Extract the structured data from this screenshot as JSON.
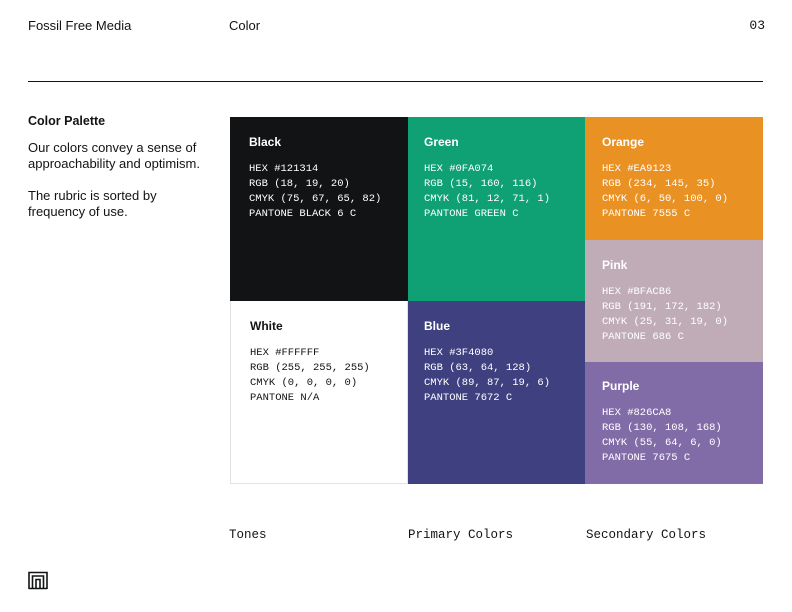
{
  "header": {
    "brand": "Fossil Free Media",
    "section": "Color",
    "page_number": "03"
  },
  "sidebar": {
    "heading": "Color Palette",
    "paragraph_1": "Our colors convey a sense of approachability and optimism.",
    "paragraph_2": "The rubric is sorted by frequency of use."
  },
  "colors": {
    "black": {
      "name": "Black",
      "hex": "HEX #121314",
      "rgb": "RGB (18, 19, 20)",
      "cmyk": "CMYK (75, 67, 65, 82)",
      "pantone": "PANTONE BLACK 6 C",
      "swatch": "#121314"
    },
    "white": {
      "name": "White",
      "hex": "HEX #FFFFFF",
      "rgb": "RGB (255, 255, 255)",
      "cmyk": "CMYK (0, 0, 0, 0)",
      "pantone": "PANTONE N/A",
      "swatch": "#FFFFFF"
    },
    "green": {
      "name": "Green",
      "hex": "HEX #0FA074",
      "rgb": "RGB (15, 160, 116)",
      "cmyk": "CMYK (81, 12, 71, 1)",
      "pantone": "PANTONE GREEN C",
      "swatch": "#0FA074"
    },
    "blue": {
      "name": "Blue",
      "hex": "HEX #3F4080",
      "rgb": "RGB (63, 64, 128)",
      "cmyk": "CMYK (89, 87, 19, 6)",
      "pantone": "PANTONE 7672 C",
      "swatch": "#3F4080"
    },
    "orange": {
      "name": "Orange",
      "hex": "HEX #EA9123",
      "rgb": "RGB (234, 145, 35)",
      "cmyk": "CMYK (6, 50, 100, 0)",
      "pantone": "PANTONE 7555 C",
      "swatch": "#EA9123"
    },
    "pink": {
      "name": "Pink",
      "hex": "HEX #BFACB6",
      "rgb": "RGB (191, 172, 182)",
      "cmyk": "CMYK (25, 31, 19, 0)",
      "pantone": "PANTONE 686 C",
      "swatch": "#BFACB6"
    },
    "purple": {
      "name": "Purple",
      "hex": "HEX #826CA8",
      "rgb": "RGB (130, 108, 168)",
      "cmyk": "CMYK (55, 64, 6, 0)",
      "pantone": "PANTONE 7675 C",
      "swatch": "#826CA8"
    }
  },
  "column_labels": {
    "tones": "Tones",
    "primary": "Primary Colors",
    "secondary": "Secondary Colors"
  },
  "logo_icon": "ffm-logo-icon"
}
